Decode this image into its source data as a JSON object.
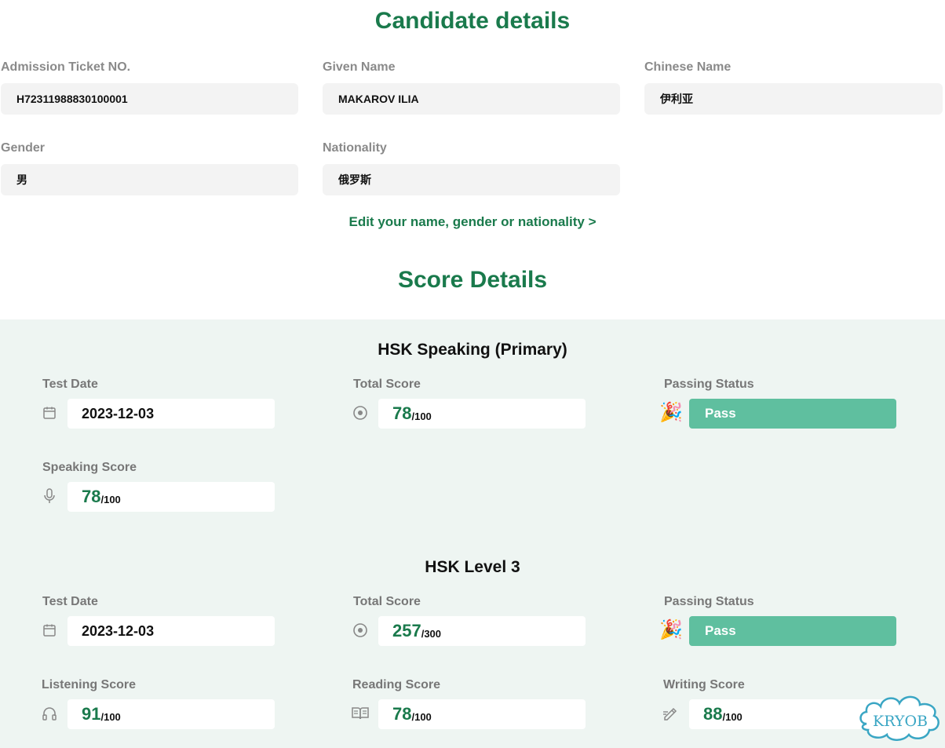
{
  "candidate": {
    "title": "Candidate details",
    "fields": {
      "admission": {
        "label": "Admission Ticket NO.",
        "value": "H72311988830100001"
      },
      "given_name": {
        "label": "Given Name",
        "value": "MAKAROV ILIA"
      },
      "chinese_name": {
        "label": "Chinese Name",
        "value": "伊利亚"
      },
      "gender": {
        "label": "Gender",
        "value": "男"
      },
      "nationality": {
        "label": "Nationality",
        "value": "俄罗斯"
      }
    },
    "edit_link": "Edit your name, gender or nationality >"
  },
  "scores": {
    "title": "Score Details",
    "exam1": {
      "title": "HSK Speaking (Primary)",
      "test_date_label": "Test Date",
      "test_date": "2023-12-03",
      "total_label": "Total Score",
      "total": "78",
      "total_max": "/100",
      "passing_label": "Passing Status",
      "passing": "Pass",
      "speaking_label": "Speaking Score",
      "speaking": "78",
      "speaking_max": "/100"
    },
    "exam2": {
      "title": "HSK Level 3",
      "test_date_label": "Test Date",
      "test_date": "2023-12-03",
      "total_label": "Total Score",
      "total": "257",
      "total_max": "/300",
      "passing_label": "Passing Status",
      "passing": "Pass",
      "listening_label": "Listening Score",
      "listening": "91",
      "listening_max": "/100",
      "reading_label": "Reading Score",
      "reading": "78",
      "reading_max": "/100",
      "writing_label": "Writing Score",
      "writing": "88",
      "writing_max": "/100"
    }
  },
  "icons": {
    "calendar": "calendar-icon",
    "target": "target-icon",
    "party": "party-popper-icon",
    "microphone": "microphone-icon",
    "headphones": "headphones-icon",
    "book": "book-icon",
    "pencil": "pencil-icon"
  },
  "watermark": "KRYOB",
  "colors": {
    "accent": "#1a7a4c",
    "pass": "#5fbf9f",
    "panel": "#eef5f2",
    "field_bg": "#f3f3f3"
  }
}
